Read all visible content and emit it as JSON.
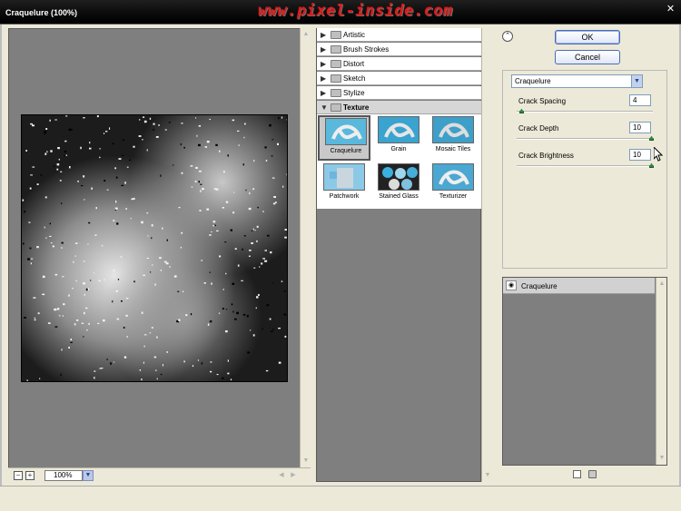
{
  "window": {
    "title": "Craquelure (100%)",
    "watermark": "www.pixel-inside.com",
    "close_icon": "close-icon"
  },
  "preview": {
    "zoom": "100%",
    "zoom_out": "−",
    "zoom_in": "+",
    "dropdown_icon": "chevron-down-icon"
  },
  "gallery": {
    "categories": [
      {
        "label": "Artistic",
        "expanded": false
      },
      {
        "label": "Brush Strokes",
        "expanded": false
      },
      {
        "label": "Distort",
        "expanded": false
      },
      {
        "label": "Sketch",
        "expanded": false
      },
      {
        "label": "Stylize",
        "expanded": false
      },
      {
        "label": "Texture",
        "expanded": true
      }
    ],
    "thumbnails": [
      {
        "label": "Craquelure",
        "selected": true
      },
      {
        "label": "Grain",
        "selected": false
      },
      {
        "label": "Mosaic Tiles",
        "selected": false
      },
      {
        "label": "Patchwork",
        "selected": false
      },
      {
        "label": "Stained Glass",
        "selected": false
      },
      {
        "label": "Texturizer",
        "selected": false
      }
    ]
  },
  "buttons": {
    "ok": "OK",
    "cancel": "Cancel",
    "collapse": "⌃"
  },
  "settings": {
    "filter_select": "Craquelure",
    "params": [
      {
        "label": "Crack Spacing",
        "value": "4",
        "min": 2,
        "max": 100,
        "current": 4
      },
      {
        "label": "Crack Depth",
        "value": "10",
        "min": 0,
        "max": 10,
        "current": 10
      },
      {
        "label": "Crack Brightness",
        "value": "10",
        "min": 0,
        "max": 10,
        "current": 10
      }
    ]
  },
  "layers": {
    "items": [
      {
        "label": "Craquelure",
        "visible": true
      }
    ]
  },
  "colors": {
    "accent": "#4a6bb5",
    "slider_thumb": "#2f8a3f",
    "watermark": "#e01818"
  }
}
